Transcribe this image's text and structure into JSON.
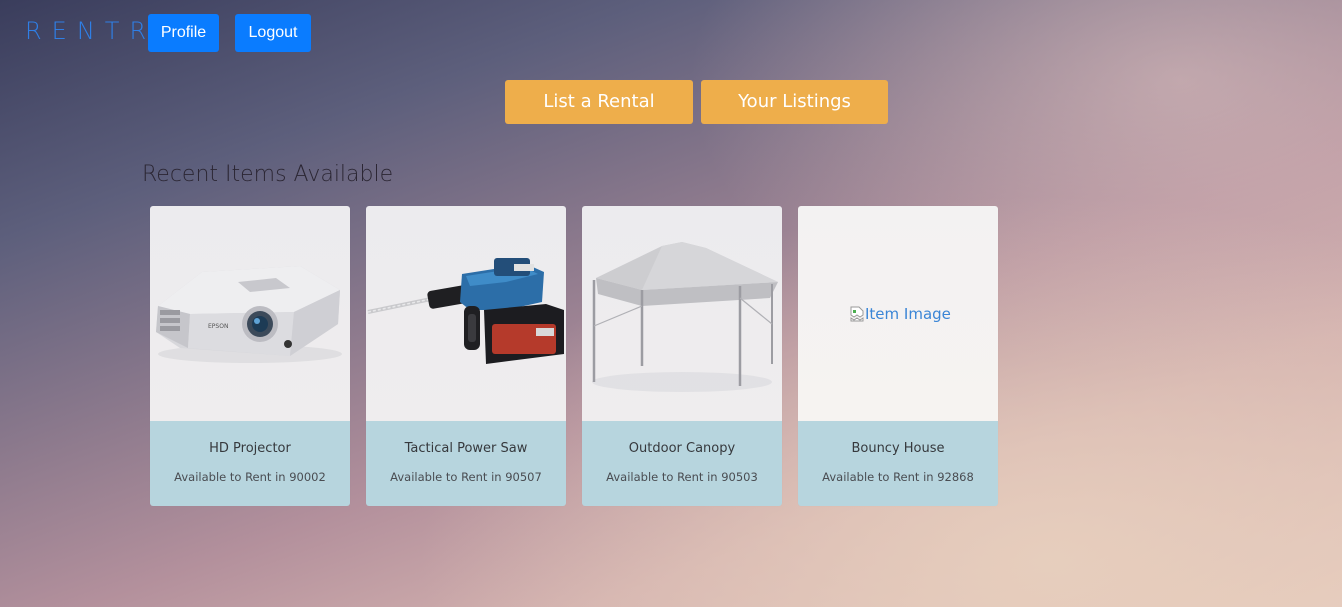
{
  "header": {
    "logo": "RENTR",
    "profile_label": "Profile",
    "logout_label": "Logout"
  },
  "actions": {
    "list_rental_label": "List a Rental",
    "your_listings_label": "Your Listings"
  },
  "section": {
    "title": "Recent Items Available"
  },
  "items": [
    {
      "name": "HD Projector",
      "location": "Available to Rent in 90002",
      "image": "projector-image"
    },
    {
      "name": "Tactical Power Saw",
      "location": "Available to Rent in 90507",
      "image": "power-drill-image"
    },
    {
      "name": "Outdoor Canopy",
      "location": "Available to Rent in 90503",
      "image": "canopy-tent-image"
    },
    {
      "name": "Bouncy House",
      "location": "Available to Rent in 92868",
      "image": "broken-image",
      "image_alt": "Item Image"
    }
  ],
  "colors": {
    "brand_blue": "#0a7cff",
    "logo_blue": "#2f7fe6",
    "action_orange": "#eeae4b",
    "card_body": "#b7d5de"
  }
}
